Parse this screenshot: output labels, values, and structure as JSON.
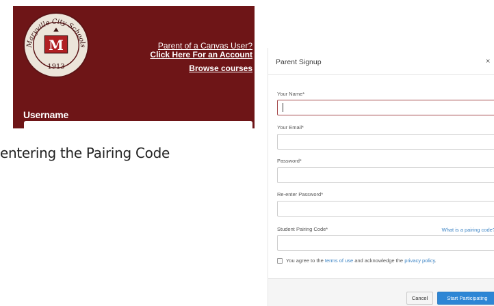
{
  "login": {
    "parent_prompt": "Parent of a Canvas User?",
    "parent_link": "Click Here For an Account",
    "browse_link": "Browse courses",
    "username_label": "Username",
    "seal": {
      "top_text": "Maryville City Schools",
      "letter": "M",
      "year": "1913"
    },
    "colors": {
      "brand": "#6e1517"
    }
  },
  "caption": "entering the Pairing Code",
  "dialog": {
    "title": "Parent Signup",
    "close_glyph": "×",
    "fields": [
      {
        "label": "Your Name*",
        "value": ""
      },
      {
        "label": "Your Email*",
        "value": ""
      },
      {
        "label": "Password*",
        "value": ""
      },
      {
        "label": "Re-enter Password*",
        "value": ""
      },
      {
        "label": "Student Pairing Code*",
        "value": ""
      }
    ],
    "pairing_help": "What is a pairing code?",
    "agree": {
      "prefix": "You agree to the ",
      "terms": "terms of use",
      "middle": " and acknowledge the ",
      "privacy": "privacy policy",
      "suffix": "."
    },
    "buttons": {
      "cancel": "Cancel",
      "start": "Start Participating"
    },
    "colors": {
      "primary": "#2d86d5",
      "link": "#3b83c4"
    }
  }
}
